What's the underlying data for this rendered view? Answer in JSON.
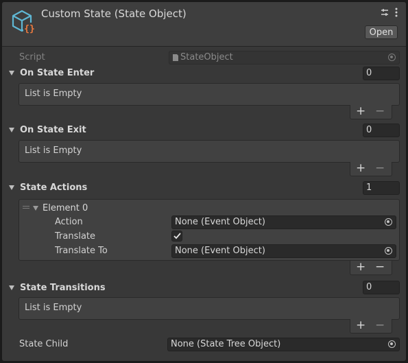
{
  "header": {
    "title": "Custom State (State Object)",
    "open_button": "Open",
    "icons": [
      "state-object-icon",
      "tool-icon",
      "kebab-menu-icon"
    ]
  },
  "script": {
    "label": "Script",
    "value": "StateObject"
  },
  "on_state_enter": {
    "label": "On State Enter",
    "count": "0",
    "empty_text": "List is Empty"
  },
  "on_state_exit": {
    "label": "On State Exit",
    "count": "0",
    "empty_text": "List is Empty"
  },
  "state_actions": {
    "label": "State Actions",
    "count": "1",
    "element": {
      "label": "Element 0",
      "action_label": "Action",
      "action_value": "None (Event Object)",
      "translate_label": "Translate",
      "translate_checked": true,
      "translate_to_label": "Translate To",
      "translate_to_value": "None (Event Object)"
    }
  },
  "state_transitions": {
    "label": "State Transitions",
    "count": "0",
    "empty_text": "List is Empty"
  },
  "state_child": {
    "label": "State Child",
    "value": "None (State Tree Object)"
  },
  "list_controls": {
    "add": "+",
    "remove": "−"
  },
  "colors": {
    "panel": "#383838",
    "header": "#3e3e3e",
    "field": "#2a2a2a",
    "logo_blue": "#5fb7d4",
    "logo_orange": "#f07b3f"
  }
}
